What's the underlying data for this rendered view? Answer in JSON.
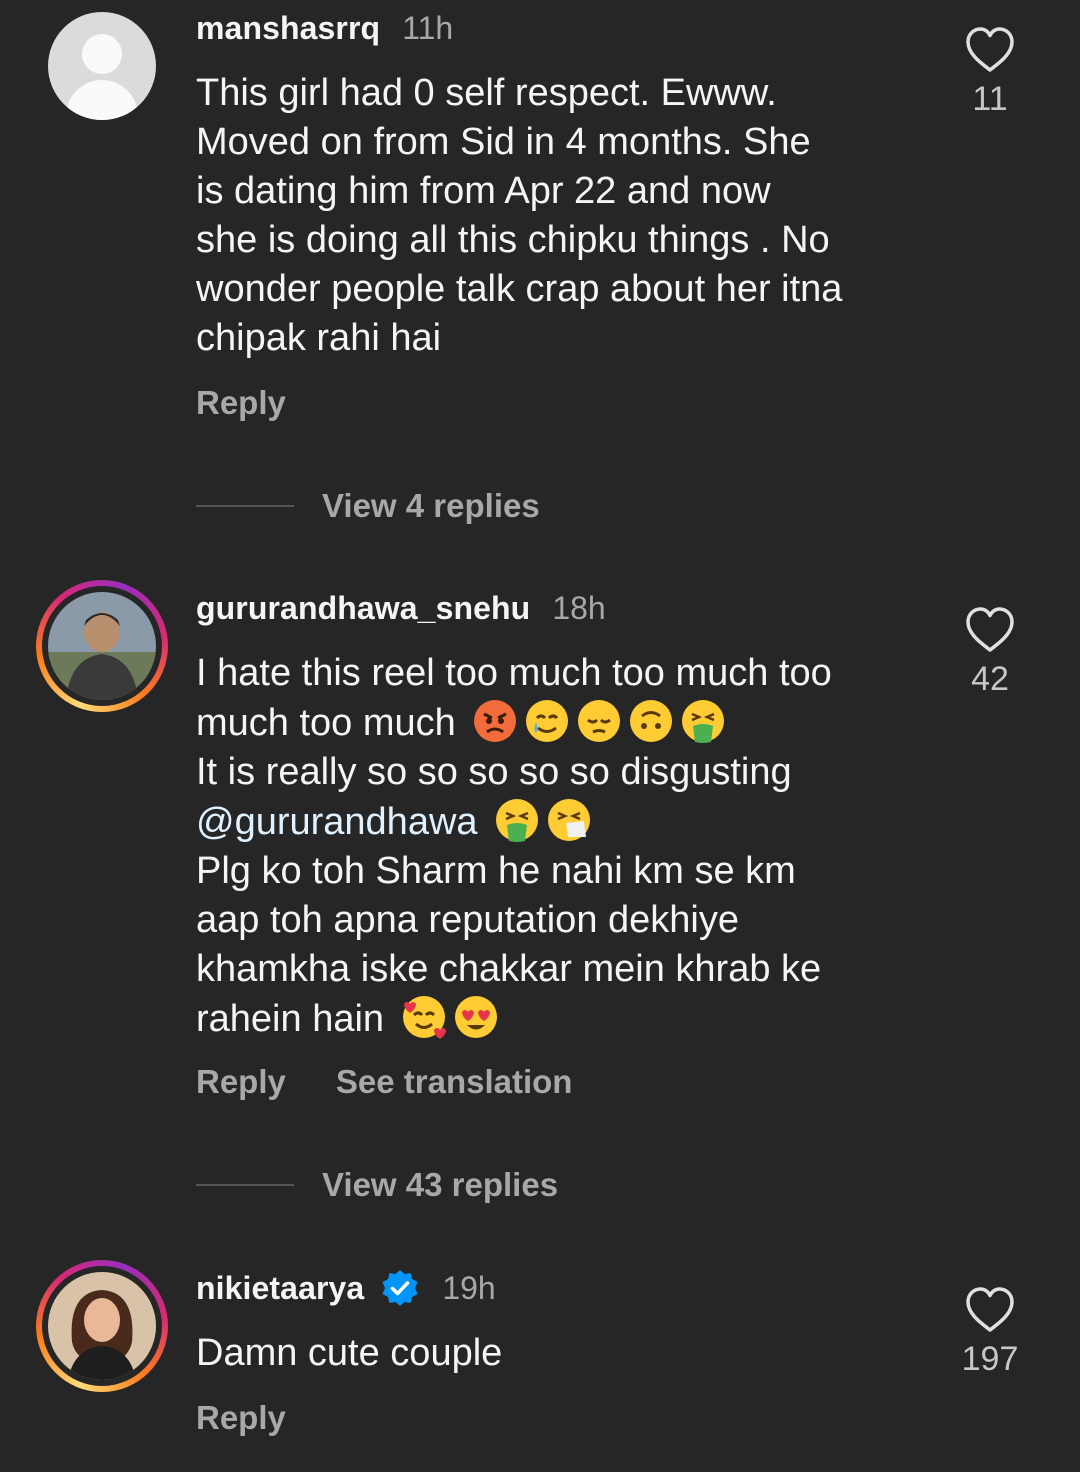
{
  "comments": [
    {
      "username": "manshasrrq",
      "time": "11h",
      "lines": [
        "This girl had 0 self respect. Ewww.",
        "Moved on from Sid in 4 months. She",
        "is dating him from Apr 22 and now",
        "she is doing all this chipku things . No",
        "wonder people talk crap about her  itna",
        "chipak rahi hai"
      ],
      "like_count": "11",
      "reply_label": "Reply",
      "view_replies": "View 4 replies"
    },
    {
      "username": "gururandhawa_snehu",
      "time": "18h",
      "line1": "I hate this reel too much too much too",
      "line2_text": "much too much",
      "line3": "It is really so so so so so disgusting",
      "mention": "@gururandhawa",
      "line5": "Plg ko toh Sharm he nahi km se km",
      "line6": "aap toh apna reputation dekhiye",
      "line7": "khamkha iske chakkar mein khrab ke",
      "line8_text": "rahein hain",
      "like_count": "42",
      "reply_label": "Reply",
      "translation_label": "See translation",
      "view_replies": "View 43 replies"
    },
    {
      "username": "nikietaarya",
      "time": "19h",
      "text": "Damn cute couple",
      "like_count": "197",
      "reply_label": "Reply"
    }
  ],
  "icons": {
    "like": "heart-outline-icon",
    "verified": "verified-badge-icon",
    "default_avatar": "default-avatar-icon"
  },
  "colors": {
    "background": "#262626",
    "text": "#f5f5f5",
    "muted": "#a8a8a8",
    "verified": "#0095f6"
  }
}
